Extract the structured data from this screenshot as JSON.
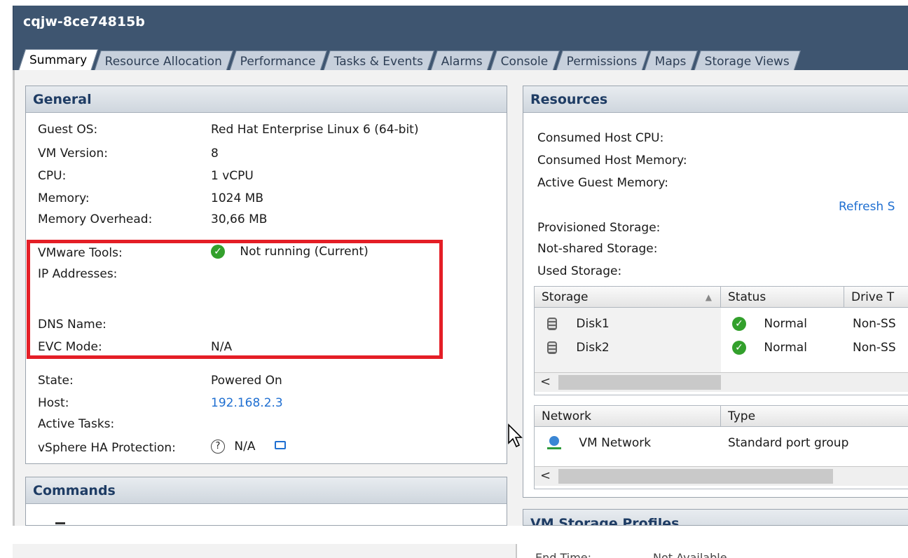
{
  "window": {
    "title": "cqjw-8ce74815b"
  },
  "tabs": [
    {
      "label": "Summary",
      "active": true
    },
    {
      "label": "Resource Allocation"
    },
    {
      "label": "Performance"
    },
    {
      "label": "Tasks & Events"
    },
    {
      "label": "Alarms"
    },
    {
      "label": "Console"
    },
    {
      "label": "Permissions"
    },
    {
      "label": "Maps"
    },
    {
      "label": "Storage Views"
    }
  ],
  "general": {
    "header": "General",
    "guest_os_label": "Guest OS:",
    "guest_os": "Red Hat Enterprise Linux 6 (64-bit)",
    "vm_version_label": "VM Version:",
    "vm_version": "8",
    "cpu_label": "CPU:",
    "cpu": "1 vCPU",
    "memory_label": "Memory:",
    "memory": "1024 MB",
    "memory_overhead_label": "Memory Overhead:",
    "memory_overhead": "30,66 MB",
    "vmware_tools_label": "VMware Tools:",
    "vmware_tools": "Not running (Current)",
    "ip_addresses_label": "IP Addresses:",
    "dns_name_label": "DNS Name:",
    "evc_mode_label": "EVC Mode:",
    "evc_mode": "N/A",
    "state_label": "State:",
    "state": "Powered On",
    "host_label": "Host:",
    "host": "192.168.2.3",
    "active_tasks_label": "Active Tasks:",
    "ha_protection_label": "vSphere HA Protection:",
    "ha_protection": "N/A"
  },
  "commands": {
    "header": "Commands"
  },
  "resources": {
    "header": "Resources",
    "consumed_cpu_label": "Consumed Host CPU:",
    "consumed_memory_label": "Consumed Host Memory:",
    "active_guest_memory_label": "Active Guest Memory:",
    "refresh_link": "Refresh S",
    "provisioned_storage_label": "Provisioned Storage:",
    "not_shared_storage_label": "Not-shared Storage:",
    "used_storage_label": "Used Storage:",
    "storage_table": {
      "headers": [
        "Storage",
        "Status",
        "Drive T"
      ],
      "rows": [
        {
          "name": "Disk1",
          "status": "Normal",
          "drive": "Non-SS"
        },
        {
          "name": "Disk2",
          "status": "Normal",
          "drive": "Non-SS"
        }
      ]
    },
    "network_table": {
      "headers": [
        "Network",
        "Type"
      ],
      "rows": [
        {
          "name": "VM Network",
          "type": "Standard port group"
        }
      ]
    },
    "scroll_left": "<"
  },
  "profiles": {
    "header": "VM Storage Profiles"
  },
  "footer": {
    "end_time_label": "End Time:",
    "end_time": "Not Available"
  },
  "colors": {
    "accent": "#3e5570",
    "link": "#1f6fd1",
    "highlight_box": "#e41e26",
    "status_ok": "#33a02c"
  },
  "icons": {
    "ok": "check-circle-icon",
    "help": "question-icon",
    "comment": "comment-icon",
    "disk": "disk-icon",
    "network": "network-icon"
  }
}
